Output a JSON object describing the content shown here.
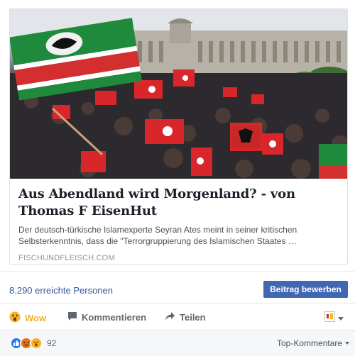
{
  "post": {
    "headline": "Aus Abendland wird Morgenland? - von Thomas F EisenHut",
    "description": "Der deutsch-türkische Islamexperte Seyran Ates meint in seiner kritischen Selbsterkenntnis, dass die \"Terrorgruppierung des Islamischen Staates …",
    "domain": "FISCHUNDFLEISCH.COM",
    "image_icon": "photo-crowd-with-flags"
  },
  "stats": {
    "reach_label": "8.290 erreichte Personen",
    "boost_button": "Beitrag bewerben",
    "boost_color": "#4267b2"
  },
  "actions": {
    "wow_label": "Wow",
    "wow_color": "#f7b125",
    "comment_label": "Kommentieren",
    "share_label": "Teilen"
  },
  "reactions": {
    "icons": [
      "like-icon",
      "angry-icon",
      "wow-icon"
    ],
    "count": "92",
    "sort_label": "Top-Kommentare"
  }
}
